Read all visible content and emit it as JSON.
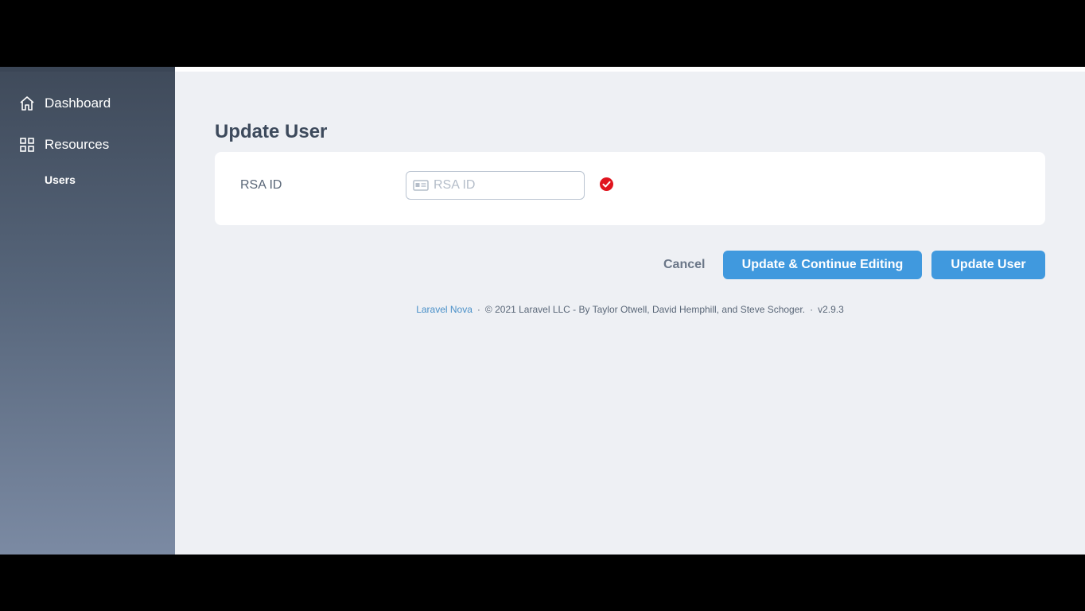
{
  "sidebar": {
    "items": [
      {
        "label": "Dashboard",
        "icon": "home-icon"
      },
      {
        "label": "Resources",
        "icon": "grid-icon"
      }
    ],
    "sub_items": [
      {
        "label": "Users"
      }
    ]
  },
  "page": {
    "title": "Update User"
  },
  "form": {
    "field_label": "RSA ID",
    "input_placeholder": "RSA ID",
    "input_value": "",
    "input_icon": "id-card-icon",
    "status_icon": "check-circle-icon"
  },
  "actions": {
    "cancel_label": "Cancel",
    "continue_label": "Update & Continue Editing",
    "update_label": "Update User"
  },
  "footer": {
    "link": "Laravel Nova",
    "text": "© 2021 Laravel LLC - By Taylor Otwell, David Hemphill, and Steve Schoger.",
    "version": "v2.9.3",
    "separator": "·"
  },
  "colors": {
    "accent": "#4099de",
    "check": "#e0141e"
  }
}
